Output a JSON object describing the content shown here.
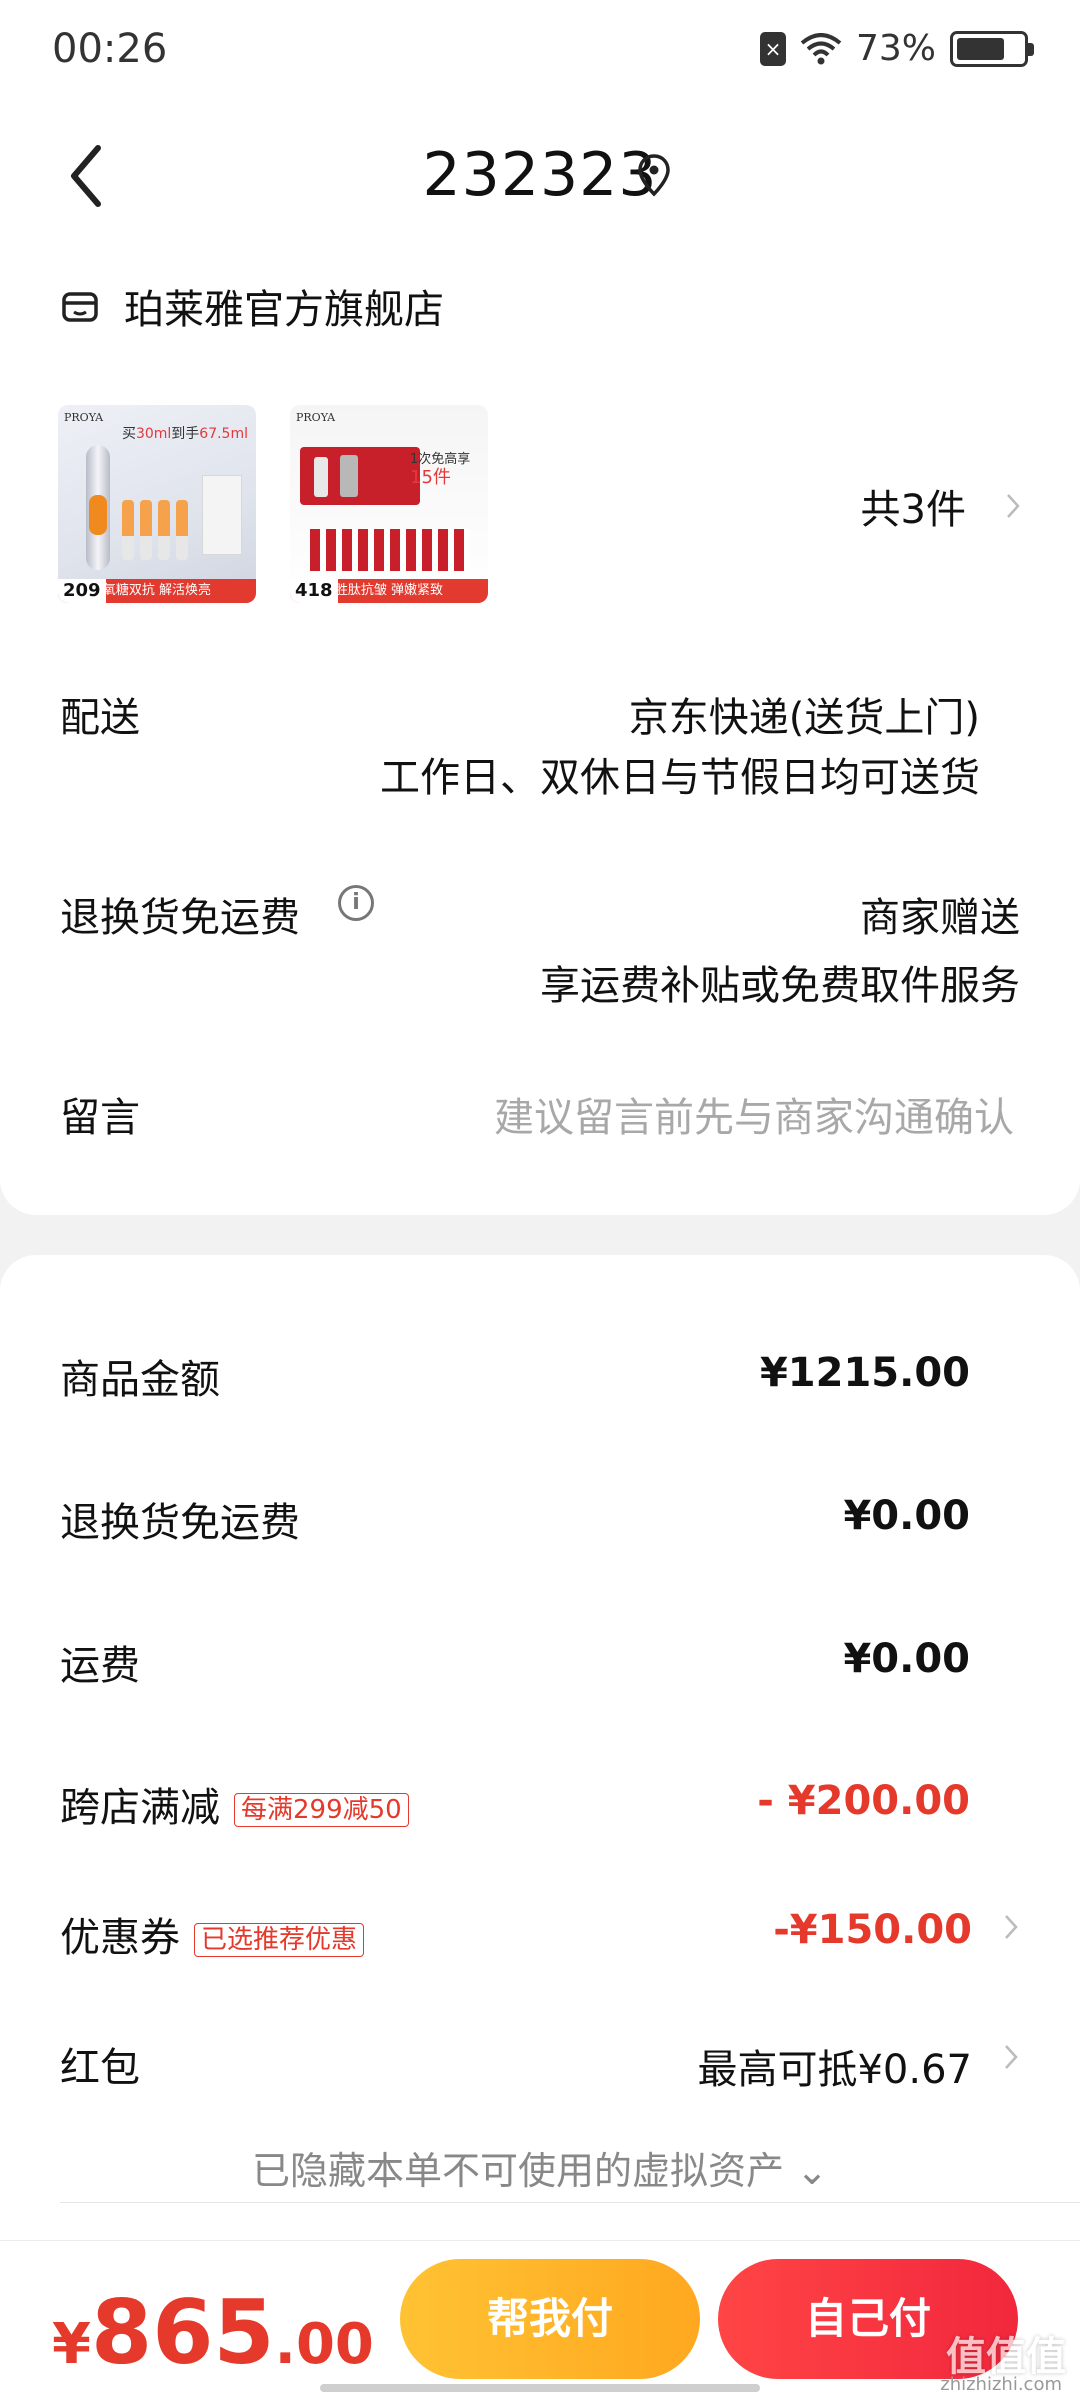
{
  "status_bar": {
    "time": "00:26",
    "battery_percent": "73%",
    "battery_level": 0.73,
    "icons": [
      "sim-icon",
      "wifi-icon",
      "battery-icon"
    ]
  },
  "nav": {
    "title": "232323",
    "back_icon": "chevron-left-icon",
    "location_icon": "location-pin-icon"
  },
  "order_card": {
    "store_name": "珀莱雅官方旗舰店",
    "store_icon": "store-icon",
    "products": [
      {
        "brand": "PROYA",
        "promo": "买30ml到手67.5ml",
        "promo_prefix": "买",
        "promo_hl": "30ml",
        "promo_mid": "到手",
        "promo_hl2": "67.5ml",
        "price": "209",
        "footer": "氧糖双抗 解活焕亮"
      },
      {
        "brand": "PROYA",
        "promo_prefix": "1次免高享",
        "promo_hl": "15件",
        "price": "418",
        "footer": "胜肽抗皱 弹嫩紧致"
      }
    ],
    "count_text": "共3件",
    "delivery": {
      "label": "配送",
      "line1": "京东快递(送货上门)",
      "line2": "工作日、双休日与节假日均可送货"
    },
    "return_shipping": {
      "label": "退换货免运费",
      "line1": "商家赠送",
      "line2": "享运费补贴或免费取件服务"
    },
    "message": {
      "label": "留言",
      "placeholder": "建议留言前先与商家沟通确认"
    }
  },
  "amounts": {
    "goods": {
      "label": "商品金额",
      "value": "¥1215.00"
    },
    "return_fee": {
      "label": "退换货免运费",
      "value": "¥0.00"
    },
    "shipping": {
      "label": "运费",
      "value": "¥0.00"
    },
    "cross_store": {
      "label": "跨店满减",
      "tag": "每满299减50",
      "value": "- ¥200.00"
    },
    "coupon": {
      "label": "优惠券",
      "tag": "已选推荐优惠",
      "value": "-¥150.00"
    },
    "red_packet": {
      "label": "红包",
      "value": "最高可抵¥0.67"
    },
    "hidden_assets": "已隐藏本单不可使用的虚拟资产 ⌄"
  },
  "bottom_bar": {
    "currency": "¥",
    "total_int": "865",
    "total_dec": ".00",
    "help_pay": "帮我付",
    "self_pay": "自己付"
  },
  "watermark": {
    "text": "值值值",
    "sub": "zhizhizhi.com"
  },
  "colors": {
    "accent_red": "#e4392b",
    "help_button": "#ffb52a",
    "self_button": "#f2273d"
  }
}
